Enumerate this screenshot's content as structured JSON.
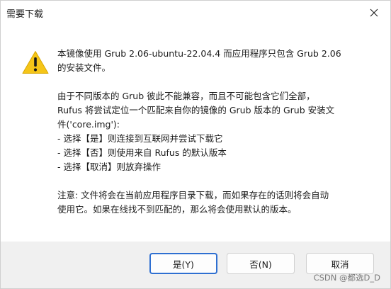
{
  "window": {
    "title": "需要下载",
    "close_symbol": "✕"
  },
  "message": {
    "lines": [
      "本镜像使用 Grub 2.06-ubuntu-22.04.4 而应用程序只包含 Grub 2.06",
      "的安装文件。",
      "",
      "由于不同版本的 Grub 彼此不能兼容，而且不可能包含它们全部，",
      "Rufus 将尝试定位一个匹配来自你的镜像的 Grub 版本的 Grub 安装文",
      "件('core.img'):",
      "- 选择【是】则连接到互联网并尝试下载它",
      "- 选择【否】则使用来自 Rufus 的默认版本",
      "- 选择【取消】则放弃操作",
      "",
      "注意: 文件将会在当前应用程序目录下载，而如果存在的话则将会自动",
      "使用它。如果在线找不到匹配的，那么将会使用默认的版本。"
    ]
  },
  "buttons": {
    "yes_label": "是(Y)",
    "no_label": "否(N)",
    "cancel_label": "取消"
  },
  "watermark": "CSDN @都选D_D",
  "icon": {
    "name": "warning-icon",
    "color": "#f5c518",
    "mark_color": "#1b1b1b"
  }
}
